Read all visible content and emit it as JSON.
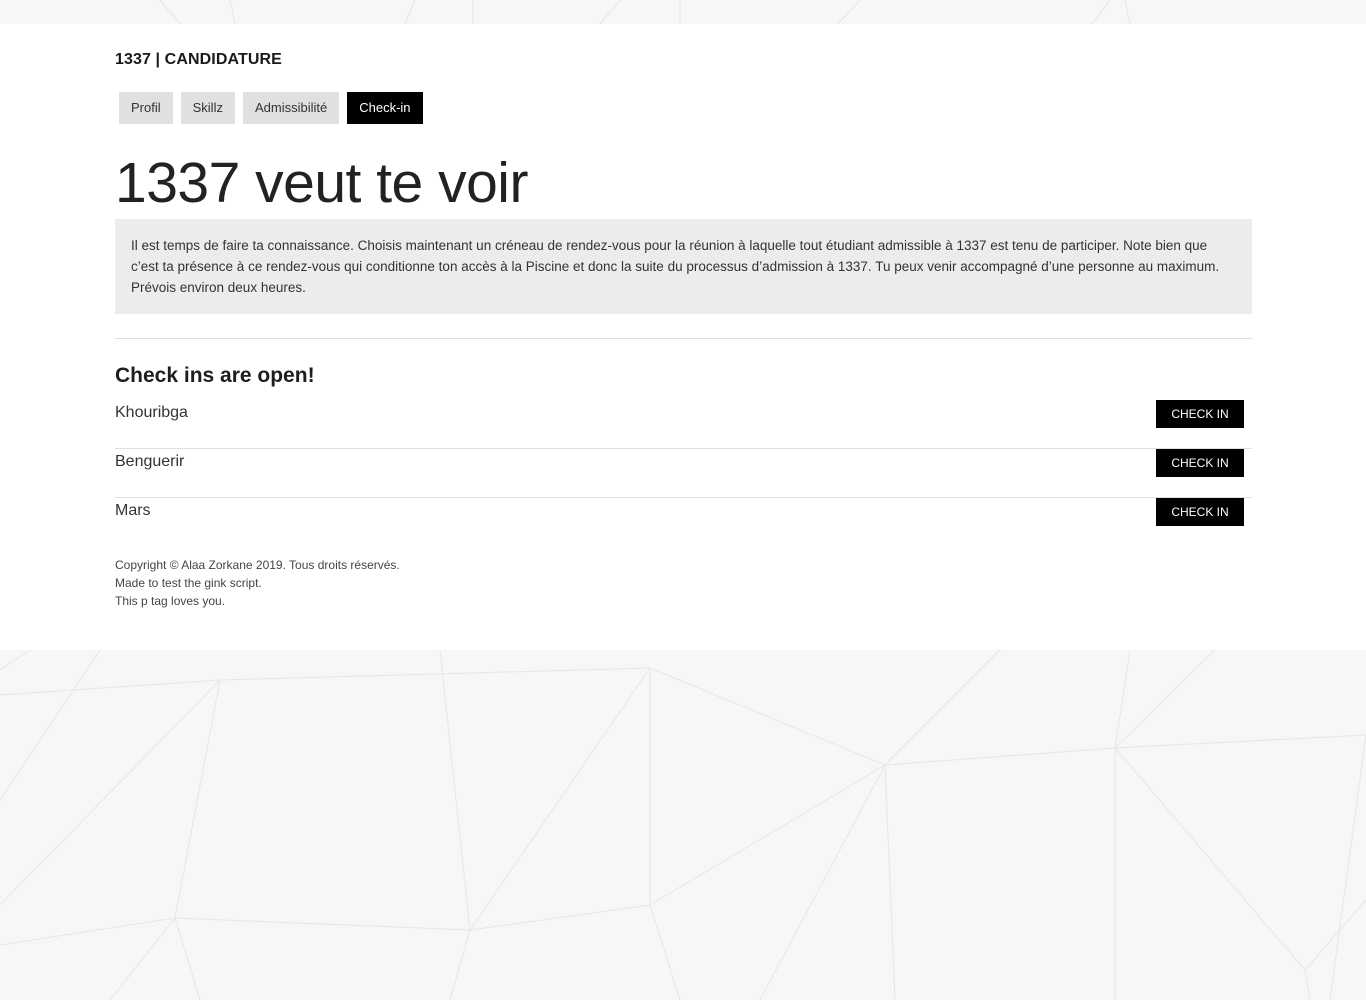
{
  "header": {
    "brand": "1337 | CANDIDATURE"
  },
  "tabs": [
    {
      "label": "Profil",
      "active": false
    },
    {
      "label": "Skillz",
      "active": false
    },
    {
      "label": "Admissibilité",
      "active": false
    },
    {
      "label": "Check-in",
      "active": true
    }
  ],
  "main": {
    "headline": "1337 veut te voir",
    "info": "Il est temps de faire ta connaissance. Choisis maintenant un créneau de rendez-vous pour la réunion à laquelle tout étudiant admissible à 1337 est tenu de participer. Note bien que c’est ta présence à ce rendez-vous qui conditionne ton accès à la Piscine et donc la suite du processus d’admission à 1337. Tu peux venir accompagné d’une personne au maximum. Prévois environ deux heures.",
    "section_title": "Check ins are open!",
    "locations": [
      {
        "city": "Khouribga",
        "button": "CHECK IN"
      },
      {
        "city": "Benguerir",
        "button": "CHECK IN"
      },
      {
        "city": "Mars",
        "button": "CHECK IN"
      }
    ]
  },
  "footer": {
    "line1": "Copyright © Alaa Zorkane 2019. Tous droits réservés.",
    "line2": "Made to test the gink script.",
    "line3": "This p tag loves you."
  },
  "colors": {
    "accent": "#000000",
    "tab_bg": "#e0e0e0",
    "info_bg": "#ececec",
    "page_bg": "#f7f7f7"
  }
}
